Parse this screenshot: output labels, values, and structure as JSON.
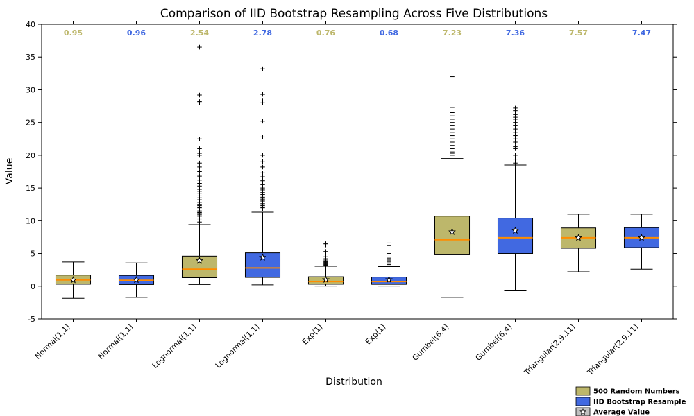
{
  "chart_data": {
    "type": "boxplot",
    "title": "Comparison of IID Bootstrap Resampling Across Five Distributions",
    "xlabel": "Distribution",
    "ylabel": "Value",
    "ylim": [
      -5,
      40
    ],
    "yticks": [
      -5,
      0,
      5,
      10,
      15,
      20,
      25,
      30,
      35,
      40
    ],
    "categories": [
      "Normal(1,1)",
      "Normal(1,1)",
      "Lognormal(1,1)",
      "Lognormal(1,1)",
      "Exp(1)",
      "Exp(1)",
      "Gumbel(6,4)",
      "Gumbel(6,4)",
      "Triangular(2,9,11)",
      "Triangular(2,9,11)"
    ],
    "palette": {
      "a": "#BDB76B",
      "b": "#4169E1",
      "median": "#FF8C00",
      "flier": "#000000",
      "grid": "#000000"
    },
    "legend": {
      "a_label": "500 Random Numbers",
      "b_label": "IID Bootstrap Resample",
      "mean_label": "Average Value"
    },
    "annotations": [
      "0.95",
      "0.96",
      "2.54",
      "2.78",
      "0.76",
      "0.68",
      "7.23",
      "7.36",
      "7.57",
      "7.47"
    ],
    "boxes": [
      {
        "group": "a",
        "q1": 0.3,
        "median": 0.95,
        "q3": 1.7,
        "wlow": -1.85,
        "whigh": 3.7,
        "mean": 0.95,
        "fliers": []
      },
      {
        "group": "b",
        "q1": 0.25,
        "median": 0.9,
        "q3": 1.65,
        "wlow": -1.7,
        "whigh": 3.55,
        "mean": 0.96,
        "fliers": []
      },
      {
        "group": "a",
        "q1": 1.3,
        "median": 2.6,
        "q3": 4.6,
        "wlow": 0.25,
        "whigh": 9.4,
        "mean": 3.9,
        "fliers": [
          9.8,
          10.1,
          10.4,
          10.7,
          10.7,
          10.9,
          11.2,
          11.3,
          11.5,
          11.8,
          12.0,
          12.3,
          12.5,
          12.8,
          13.2,
          13.5,
          13.8,
          14.2,
          14.5,
          14.8,
          15.3,
          15.7,
          16.2,
          16.8,
          17.5,
          18.2,
          18.8,
          20.0,
          20.3,
          21.0,
          22.5,
          28.0,
          28.2,
          29.2,
          36.5
        ]
      },
      {
        "group": "b",
        "q1": 1.35,
        "median": 2.8,
        "q3": 5.1,
        "wlow": 0.2,
        "whigh": 11.3,
        "mean": 4.4,
        "fliers": [
          11.8,
          12.0,
          12.3,
          12.6,
          12.9,
          13.1,
          13.3,
          13.6,
          14.0,
          14.3,
          14.7,
          15.0,
          15.5,
          16.1,
          16.7,
          17.3,
          18.2,
          19.0,
          20.0,
          22.8,
          25.2,
          28.0,
          28.3,
          29.3,
          33.2
        ]
      },
      {
        "group": "a",
        "q1": 0.3,
        "median": 0.7,
        "q3": 1.45,
        "wlow": 0.02,
        "whigh": 3.05,
        "mean": 1.0,
        "fliers": [
          3.2,
          3.3,
          3.4,
          3.5,
          3.6,
          3.7,
          3.8,
          4.0,
          4.2,
          4.5,
          5.3,
          6.3,
          6.5
        ]
      },
      {
        "group": "b",
        "q1": 0.28,
        "median": 0.7,
        "q3": 1.4,
        "wlow": 0.02,
        "whigh": 3.0,
        "mean": 1.0,
        "fliers": [
          3.3,
          3.5,
          3.7,
          3.9,
          4.1,
          4.3,
          5.0,
          6.2,
          6.6
        ]
      },
      {
        "group": "a",
        "q1": 4.8,
        "median": 7.1,
        "q3": 10.7,
        "wlow": -1.7,
        "whigh": 19.5,
        "mean": 8.3,
        "fliers": [
          20.0,
          20.3,
          20.5,
          21.0,
          21.5,
          22.0,
          22.5,
          23.0,
          23.5,
          24.0,
          24.5,
          25.0,
          25.5,
          26.0,
          26.5,
          27.3,
          32.0
        ]
      },
      {
        "group": "b",
        "q1": 5.0,
        "median": 7.4,
        "q3": 10.4,
        "wlow": -0.6,
        "whigh": 18.5,
        "mean": 8.5,
        "fliers": [
          18.8,
          19.4,
          20.0,
          21.0,
          21.3,
          22.0,
          22.5,
          23.0,
          23.5,
          24.0,
          24.5,
          25.0,
          25.5,
          25.8,
          26.2,
          26.8,
          27.2
        ]
      },
      {
        "group": "a",
        "q1": 5.8,
        "median": 7.4,
        "q3": 8.9,
        "wlow": 2.2,
        "whigh": 11.0,
        "mean": 7.4,
        "fliers": []
      },
      {
        "group": "b",
        "q1": 5.9,
        "median": 7.4,
        "q3": 8.95,
        "wlow": 2.6,
        "whigh": 11.0,
        "mean": 7.4,
        "fliers": []
      }
    ]
  }
}
